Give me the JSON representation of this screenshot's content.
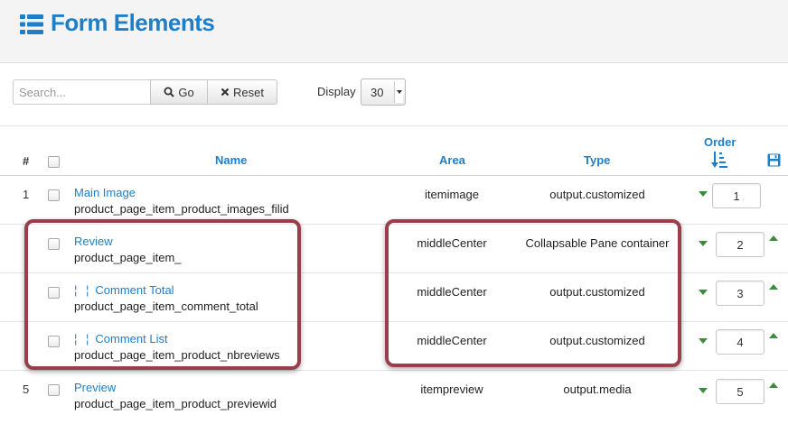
{
  "header": {
    "title": "Form Elements",
    "icon": "list-icon"
  },
  "toolbar": {
    "search_placeholder": "Search...",
    "go_label": "Go",
    "reset_label": "Reset",
    "display_label": "Display",
    "display_value": "30"
  },
  "table": {
    "columns": {
      "num": "#",
      "name": "Name",
      "area": "Area",
      "type": "Type",
      "order": "Order"
    },
    "rows": [
      {
        "num": "1",
        "name": "Main Image",
        "sub": "product_page_item_product_images_filid",
        "area": "itemimage",
        "type": "output.customized",
        "order": "1",
        "child": false
      },
      {
        "num": "",
        "name": "Review",
        "sub": "product_page_item_",
        "area": "middleCenter",
        "type": "Collapsable Pane container",
        "order": "2",
        "child": false
      },
      {
        "num": "",
        "name": "Comment Total",
        "sub": "product_page_item_comment_total",
        "area": "middleCenter",
        "type": "output.customized",
        "order": "3",
        "child": true
      },
      {
        "num": "",
        "name": "Comment List",
        "sub": "product_page_item_product_nbreviews",
        "area": "middleCenter",
        "type": "output.customized",
        "order": "4",
        "child": true
      },
      {
        "num": "5",
        "name": "Preview",
        "sub": "product_page_item_product_previewid",
        "area": "itempreview",
        "type": "output.media",
        "order": "5",
        "child": false
      }
    ],
    "child_prefix": "¦ ¦"
  },
  "colors": {
    "accent": "#1e7fc8",
    "highlight": "#9a3e4c",
    "arrow": "#3d8a3d"
  }
}
